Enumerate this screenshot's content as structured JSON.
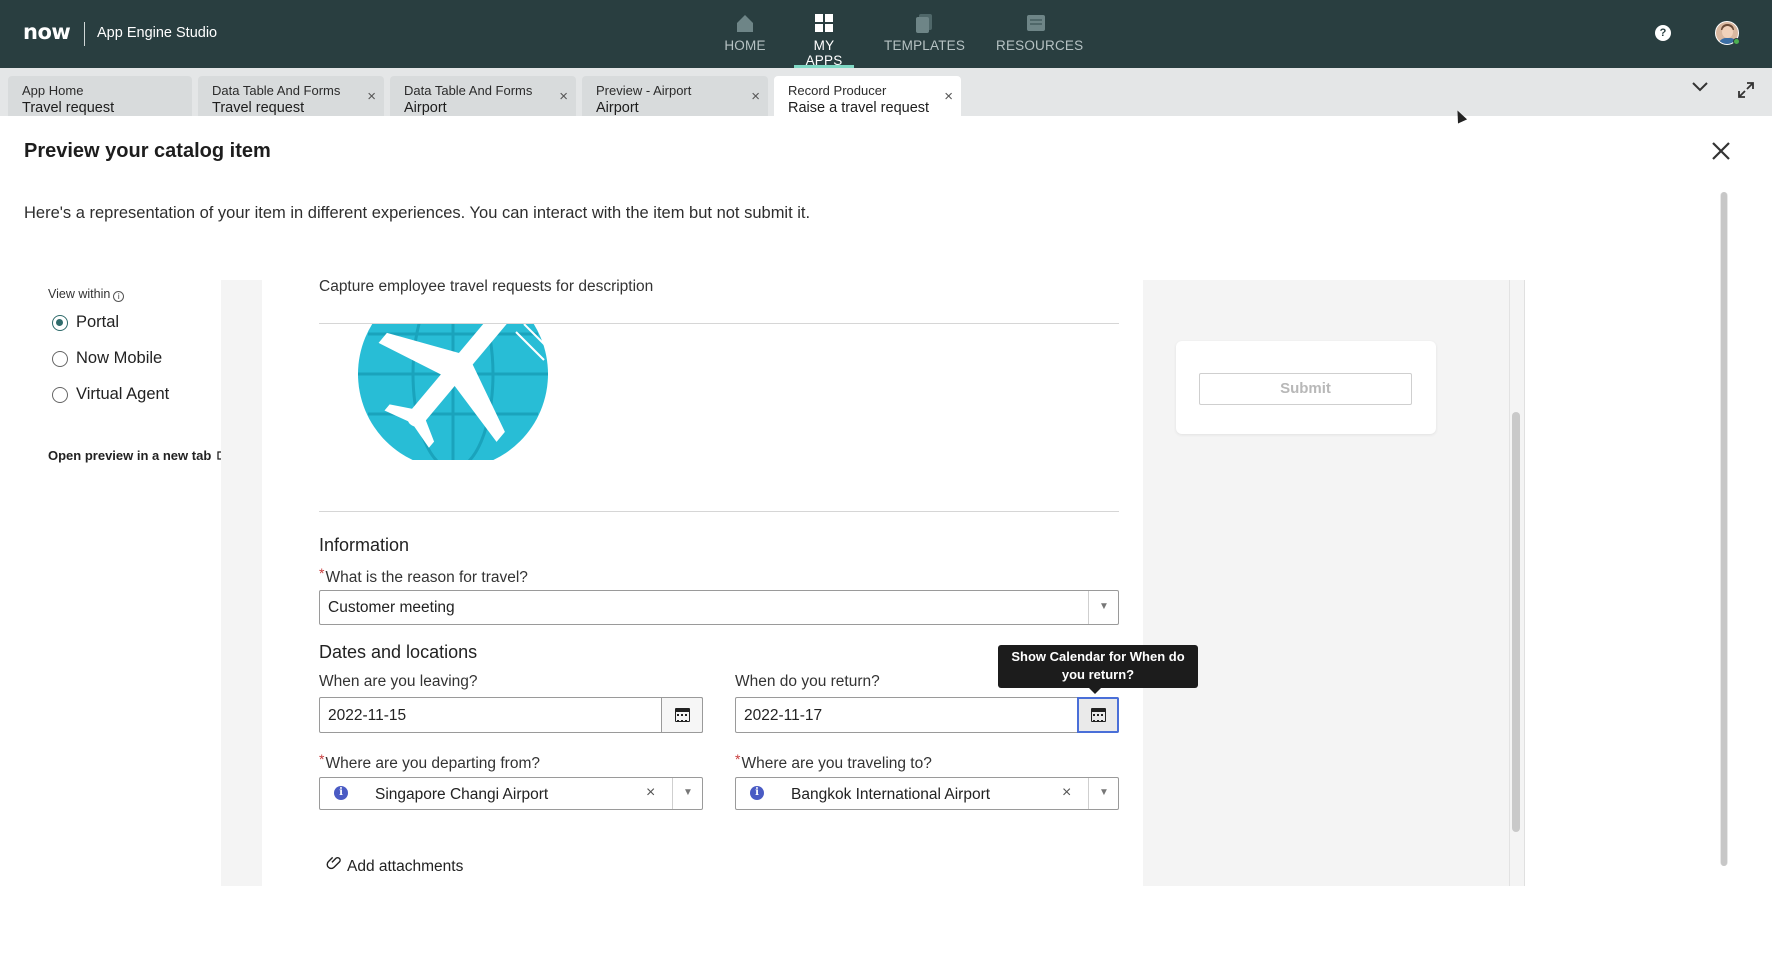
{
  "topnav": {
    "logo": "now",
    "app_name": "App Engine Studio",
    "items": [
      {
        "label": "HOME",
        "icon": "home-icon",
        "active": false
      },
      {
        "label": "MY APPS",
        "icon": "grid-icon",
        "active": true
      },
      {
        "label": "TEMPLATES",
        "icon": "templates-icon",
        "active": false
      },
      {
        "label": "RESOURCES",
        "icon": "resources-icon",
        "active": false
      }
    ],
    "help": "?",
    "colors": {
      "bar": "#293e40",
      "active_underline": "#7fd8c4"
    }
  },
  "tabs": [
    {
      "title": "App Home",
      "subtitle": "Travel request",
      "closable": false,
      "active": false
    },
    {
      "title": "Data Table And Forms",
      "subtitle": "Travel request",
      "closable": true,
      "active": false
    },
    {
      "title": "Data Table And Forms",
      "subtitle": "Airport",
      "closable": true,
      "active": false
    },
    {
      "title": "Preview - Airport",
      "subtitle": "Airport",
      "closable": true,
      "active": false
    },
    {
      "title": "Record Producer",
      "subtitle": "Raise a travel request",
      "closable": true,
      "active": true
    }
  ],
  "modal": {
    "title": "Preview your catalog item",
    "description": "Here's a representation of your item in different experiences. You can interact with the item but not submit it."
  },
  "view_within": {
    "label": "View within",
    "options": [
      {
        "label": "Portal",
        "checked": true
      },
      {
        "label": "Now Mobile",
        "checked": false
      },
      {
        "label": "Virtual Agent",
        "checked": false
      }
    ],
    "open_preview": "Open preview in a new tab"
  },
  "preview": {
    "item_description": "Capture employee travel requests for description",
    "image": "globe-airplane-image",
    "information": {
      "title": "Information",
      "reason_label": "What is the reason for travel?",
      "reason_value": "Customer meeting"
    },
    "dates": {
      "title": "Dates and locations",
      "leaving_label": "When are you leaving?",
      "leaving_value": "2022-11-15",
      "return_label": "When do you return?",
      "return_value": "2022-11-17",
      "departing_label": "Where are you departing from?",
      "departing_value": "Singapore Changi Airport",
      "traveling_label": "Where are you traveling to?",
      "traveling_value": "Bangkok International Airport",
      "tooltip": "Show Calendar for When do you return?"
    },
    "attachments": "Add attachments",
    "submit": "Submit",
    "required_mark": "*"
  }
}
